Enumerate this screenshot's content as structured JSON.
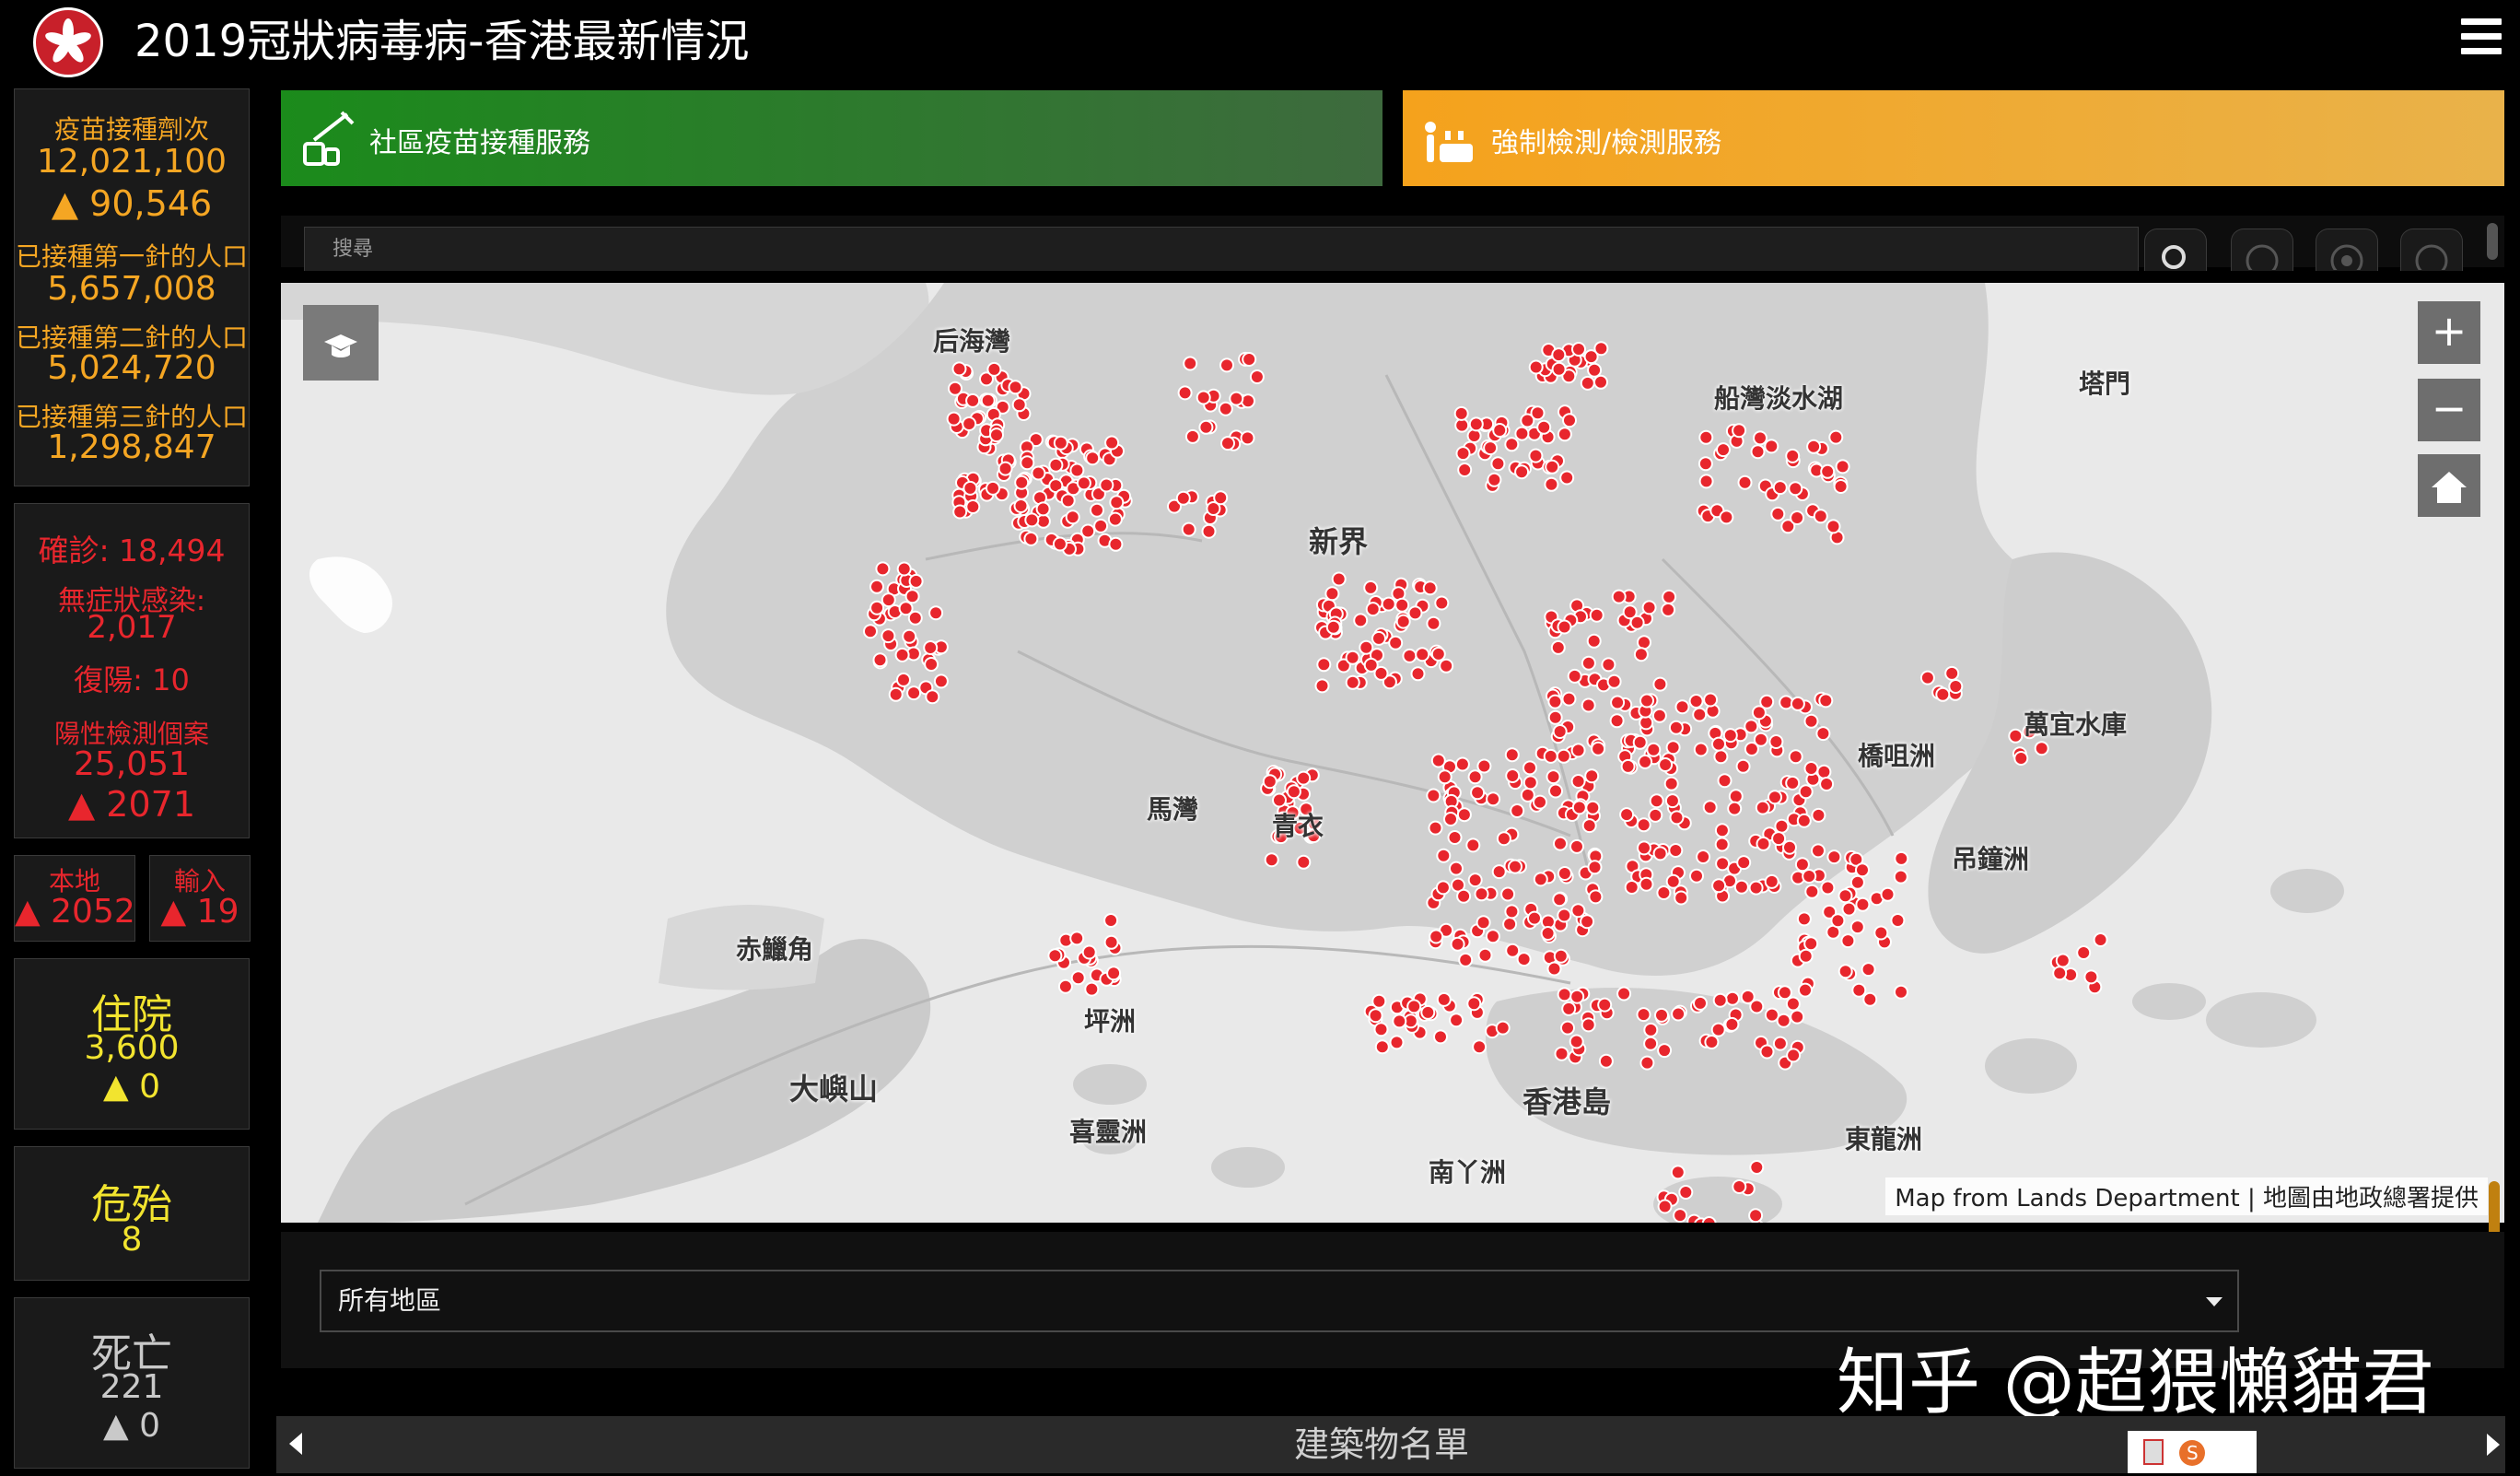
{
  "header": {
    "title": "2019冠狀病毒病-香港最新情況"
  },
  "vaccination": {
    "doses_label": "疫苗接種劑次",
    "doses_value": "12,021,100",
    "doses_change": "▲ 90,546",
    "first_label": "已接種第一針的人口",
    "first_value": "5,657,008",
    "second_label": "已接種第二針的人口",
    "second_value": "5,024,720",
    "third_label": "已接種第三針的人口",
    "third_value": "1,298,847"
  },
  "cases": {
    "confirmed": "確診: 18,494",
    "asymptomatic_label": "無症狀感染:",
    "asymptomatic_value": "2,017",
    "repositive": "復陽: 10",
    "positive_label": "陽性檢測個案",
    "positive_value": "25,051",
    "positive_change": "▲ 2071"
  },
  "local": {
    "label": "本地",
    "value": "▲ 2052"
  },
  "imported": {
    "label": "輸入",
    "value": "▲ 19"
  },
  "hospitalised": {
    "label": "住院",
    "value": "3,600",
    "change": "▲ 0"
  },
  "critical": {
    "label": "危殆",
    "value": "8"
  },
  "deaths": {
    "label": "死亡",
    "value": "221",
    "change": "▲ 0"
  },
  "actions": {
    "vaccine_service": "社區疫苗接種服務",
    "testing_service": "強制檢測/檢測服務"
  },
  "search": {
    "placeholder": "搜尋"
  },
  "map": {
    "labels": {
      "hau_hoi_wan": "后海灣",
      "new_territories": "新界",
      "sai_kung_hoi": "船灣淡水湖",
      "tap_mun": "塔門",
      "kiu_tsui": "橋咀洲",
      "high_island": "萬宜水庫",
      "ma_wan": "馬灣",
      "tsing_yi": "青衣",
      "chek_lap_kok": "赤鱲角",
      "lantau": "大嶼山",
      "peng_chau": "坪洲",
      "hei_ling_chau": "喜靈洲",
      "hk_island": "香港島",
      "lamma": "南丫洲",
      "tung_lung": "東龍洲",
      "tiu_chung": "吊鐘洲"
    },
    "zoom_in": "+",
    "zoom_out": "−",
    "attribution": "Map from Lands Department | 地圖由地政總署提供",
    "marker_color": "#e8262d"
  },
  "district_select": {
    "selected": "所有地區"
  },
  "building_list": {
    "label": "建築物名單"
  },
  "watermark": "知乎 @超猥懶貓君"
}
